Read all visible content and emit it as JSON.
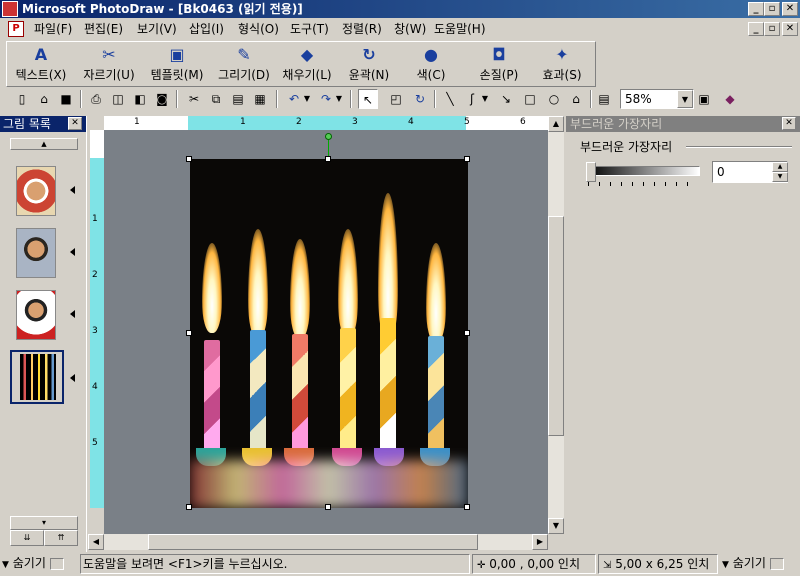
{
  "window": {
    "title": "Microsoft PhotoDraw - [Bk0463 (읽기 전용)]",
    "controls": [
      "_",
      "▫",
      "✕"
    ]
  },
  "menubar": {
    "items": [
      "파일(F)",
      "편집(E)",
      "보기(V)",
      "삽입(I)",
      "형식(O)",
      "도구(T)",
      "정렬(R)",
      "창(W)",
      "도움말(H)"
    ]
  },
  "bigtoolbar": {
    "buttons": [
      {
        "label": "텍스트(X)",
        "icon": "text-a-icon"
      },
      {
        "label": "자르기(U)",
        "icon": "scissors-icon"
      },
      {
        "label": "템플릿(M)",
        "icon": "template-icon"
      },
      {
        "label": "그리기(D)",
        "icon": "paintbrush-icon"
      },
      {
        "label": "채우기(L)",
        "icon": "paint-bucket-icon"
      },
      {
        "label": "윤곽(N)",
        "icon": "outline-swirl-icon"
      },
      {
        "label": "색(C)",
        "icon": "color-disc-icon"
      },
      {
        "label": "손질(P)",
        "icon": "touchup-icon"
      },
      {
        "label": "효과(S)",
        "icon": "effects-icon"
      }
    ]
  },
  "toolbar": {
    "zoom": "58%"
  },
  "picture_list": {
    "title": "그림 목록",
    "close": "✕"
  },
  "rulers": {
    "h_ticks": [
      "1",
      "1",
      "2",
      "3",
      "4",
      "5",
      "6"
    ],
    "v_ticks": [
      "1",
      "2",
      "3",
      "4",
      "5"
    ]
  },
  "right_panel": {
    "title": "부드러운 가장자리",
    "group_label": "부드러운 가장자리",
    "value": "0",
    "slider_fraction": 0
  },
  "statusbar": {
    "hide_left": "숨기기",
    "help": "도움말을 보려면 <F1>키를 누르십시오.",
    "position": "0,00 , 0,00 인치",
    "size": "5,00 x 6,25 인치",
    "hide_right": "숨기기"
  }
}
